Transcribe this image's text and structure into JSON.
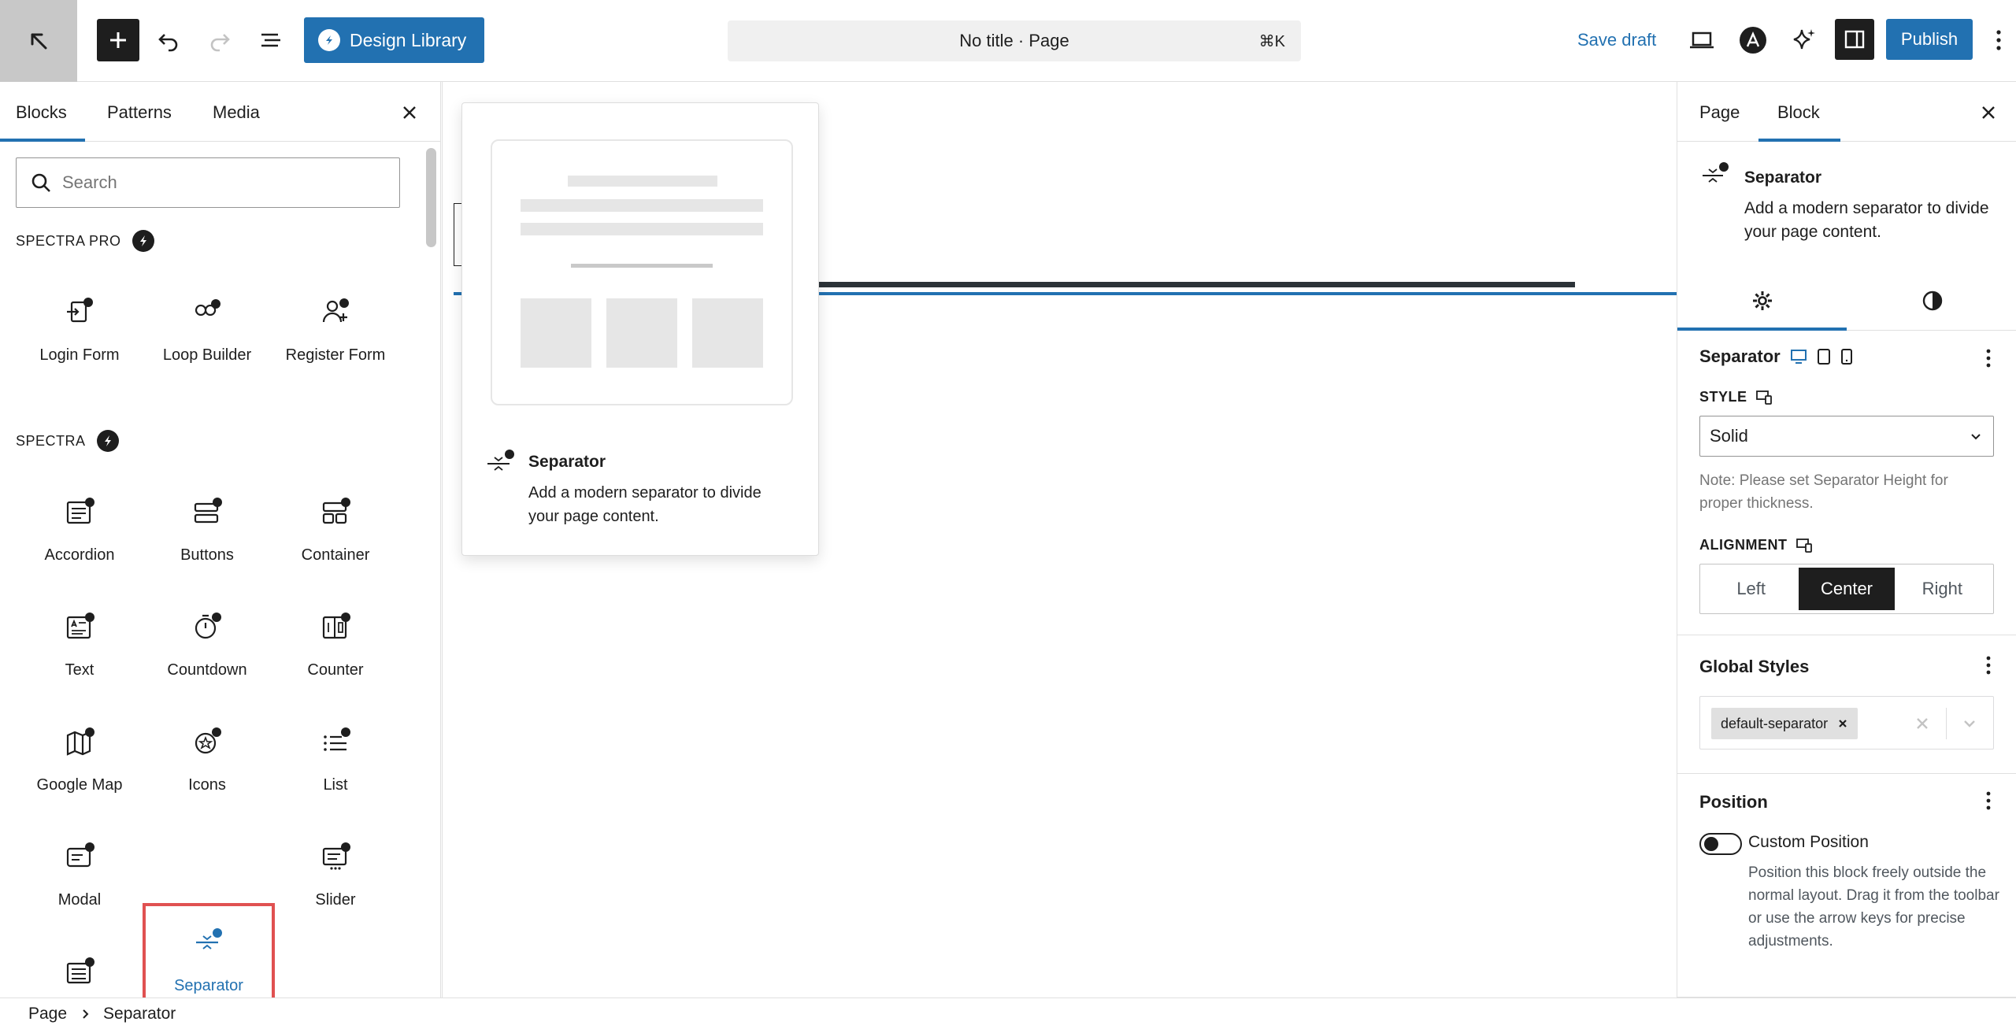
{
  "topbar": {
    "document_title": "No title · Page",
    "shortcut": "⌘K",
    "design_library_label": "Design Library",
    "save_draft_label": "Save draft",
    "publish_label": "Publish"
  },
  "inserter": {
    "tabs": [
      "Blocks",
      "Patterns",
      "Media"
    ],
    "active_tab": "Blocks",
    "search_placeholder": "Search",
    "categories": [
      {
        "title": "SPECTRA PRO",
        "blocks": [
          {
            "label": "Login Form",
            "icon": "login-form-icon"
          },
          {
            "label": "Loop Builder",
            "icon": "loop-builder-icon"
          },
          {
            "label": "Register Form",
            "icon": "register-form-icon"
          }
        ]
      },
      {
        "title": "SPECTRA",
        "blocks": [
          {
            "label": "Accordion",
            "icon": "accordion-icon"
          },
          {
            "label": "Buttons",
            "icon": "buttons-icon"
          },
          {
            "label": "Container",
            "icon": "container-icon"
          },
          {
            "label": "Text",
            "icon": "text-icon"
          },
          {
            "label": "Countdown",
            "icon": "countdown-icon"
          },
          {
            "label": "Counter",
            "icon": "counter-icon"
          },
          {
            "label": "Google Map",
            "icon": "google-map-icon"
          },
          {
            "label": "Icons",
            "icon": "icons-icon"
          },
          {
            "label": "List",
            "icon": "list-icon"
          },
          {
            "label": "Modal",
            "icon": "modal-icon"
          },
          {
            "label": "Separator",
            "icon": "separator-icon"
          },
          {
            "label": "Slider",
            "icon": "slider-icon"
          }
        ]
      }
    ],
    "selected_block": "Separator"
  },
  "preview": {
    "title": "Separator",
    "description": "Add a modern separator to divide your page content."
  },
  "settings": {
    "tabs": [
      "Page",
      "Block"
    ],
    "active_tab": "Block",
    "block_title": "Separator",
    "block_description": "Add a modern separator to divide your page content.",
    "section_title": "Separator",
    "style_label": "STYLE",
    "style_value": "Solid",
    "style_note": "Note: Please set Separator Height for proper thickness.",
    "alignment_label": "ALIGNMENT",
    "alignment_options": [
      "Left",
      "Center",
      "Right"
    ],
    "alignment_selected": "Center",
    "global_styles_title": "Global Styles",
    "global_style_token": "default-separator",
    "position_title": "Position",
    "custom_position_label": "Custom Position",
    "custom_position_enabled": false,
    "custom_position_help": "Position this block freely outside the normal layout. Drag it from the toolbar or use the arrow keys for precise adjustments."
  },
  "breadcrumb": [
    "Page",
    "Separator"
  ],
  "colors": {
    "accent": "#2271b1",
    "selection_outline": "#e05151",
    "dark": "#1e1e1e"
  }
}
